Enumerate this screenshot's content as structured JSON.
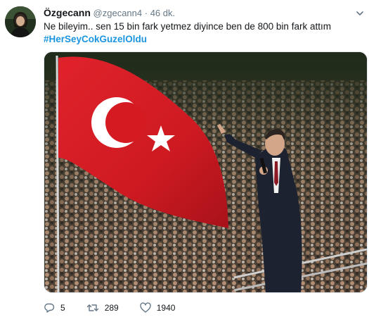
{
  "tweet": {
    "author_name": "Özgecann",
    "handle": "@zgecann4",
    "separator": "·",
    "time": "46 dk.",
    "text": "Ne bileyim.. sen 15 bin fark yetmez diyince ben de 800 bin fark attım",
    "hashtag": "#HerSeyCokGuzelOldu"
  },
  "actions": {
    "replies": "5",
    "retweets": "289",
    "likes": "1940"
  },
  "icons": {
    "reply": "reply-icon",
    "retweet": "retweet-icon",
    "like": "heart-icon",
    "menu": "chevron-down-icon"
  },
  "colors": {
    "link": "#1b95e0",
    "muted": "#657786",
    "text": "#14171a",
    "flag_red": "#d51a22"
  }
}
